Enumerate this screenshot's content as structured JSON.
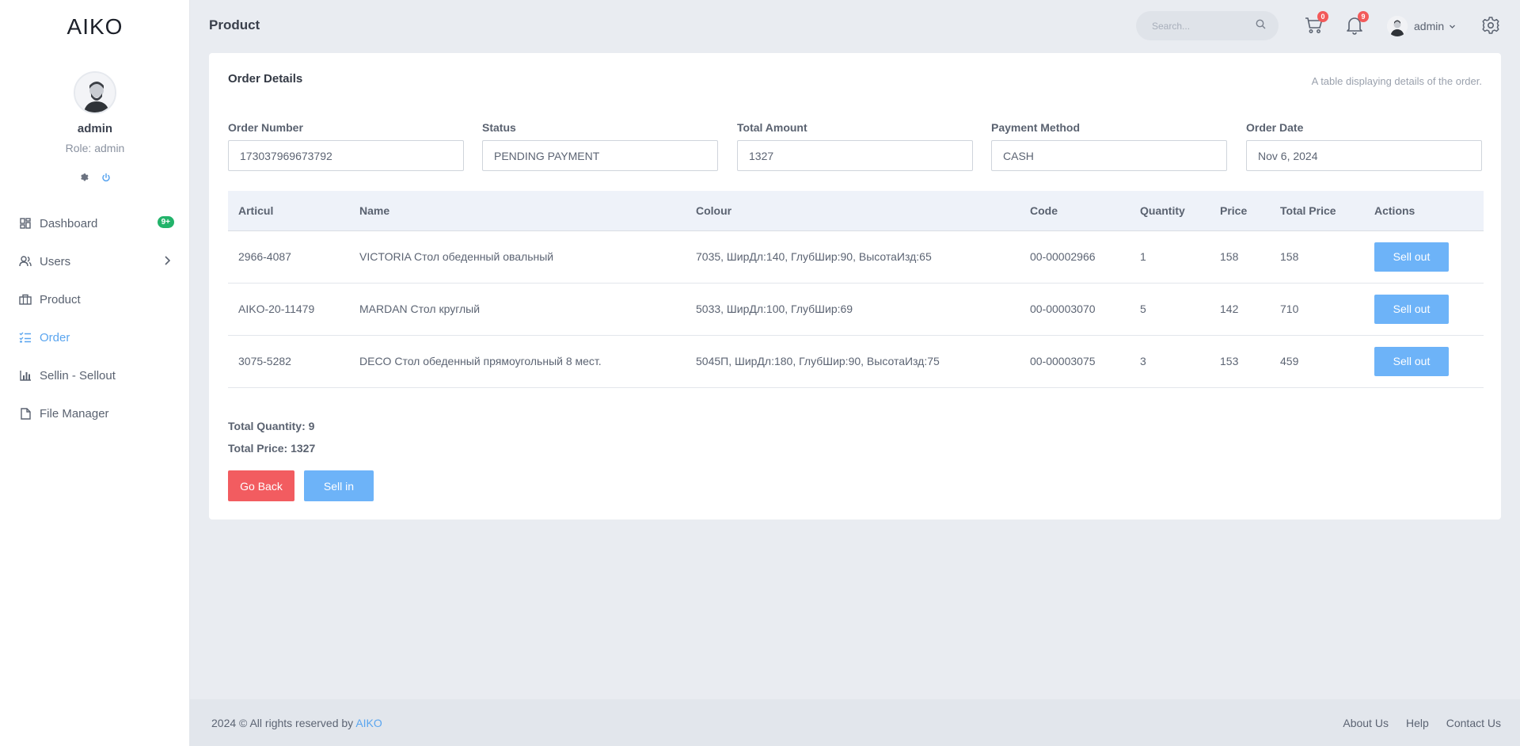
{
  "brand": {
    "logo": "AIKO"
  },
  "sidebar": {
    "user_name": "admin",
    "user_role": "Role: admin",
    "items": [
      {
        "label": "Dashboard",
        "icon": "dashboard-icon",
        "badge": "9+"
      },
      {
        "label": "Users",
        "icon": "users-icon"
      },
      {
        "label": "Product",
        "icon": "product-icon"
      },
      {
        "label": "Order",
        "icon": "order-icon",
        "active": true
      },
      {
        "label": "Sellin - Sellout",
        "icon": "chart-icon"
      },
      {
        "label": "File Manager",
        "icon": "file-icon"
      }
    ]
  },
  "header": {
    "title": "Product",
    "search_placeholder": "Search...",
    "cart_count": "0",
    "notification_count": "9",
    "user_name": "admin"
  },
  "card": {
    "title": "Order Details",
    "description": "A table displaying details of the order.",
    "fields": [
      {
        "label": "Order Number",
        "value": "173037969673792"
      },
      {
        "label": "Status",
        "value": "PENDING PAYMENT"
      },
      {
        "label": "Total Amount",
        "value": "1327"
      },
      {
        "label": "Payment Method",
        "value": "CASH"
      },
      {
        "label": "Order Date",
        "value": "Nov 6, 2024"
      }
    ],
    "table": {
      "columns": [
        "Articul",
        "Name",
        "Colour",
        "Code",
        "Quantity",
        "Price",
        "Total Price",
        "Actions"
      ],
      "rows": [
        {
          "articul": "2966-4087",
          "name": "VICTORIA Стол обеденный овальный",
          "colour": "7035, ШирДл:140, ГлубШир:90, ВысотаИзд:65",
          "code": "00-00002966",
          "quantity": "1",
          "price": "158",
          "total": "158",
          "action": "Sell out"
        },
        {
          "articul": "AIKO-20-11479",
          "name": "MARDAN Стол круглый",
          "colour": "5033, ШирДл:100, ГлубШир:69",
          "code": "00-00003070",
          "quantity": "5",
          "price": "142",
          "total": "710",
          "action": "Sell out"
        },
        {
          "articul": "3075-5282",
          "name": "DECO Стол обеденный прямоугольный 8 мест.",
          "colour": "5045П, ШирДл:180, ГлубШир:90, ВысотаИзд:75",
          "code": "00-00003075",
          "quantity": "3",
          "price": "153",
          "total": "459",
          "action": "Sell out"
        }
      ]
    },
    "total_quantity": "Total Quantity: 9",
    "total_price": "Total Price: 1327",
    "go_back_label": "Go Back",
    "sell_in_label": "Sell in"
  },
  "footer": {
    "copyright": "2024 © All rights reserved by ",
    "brand_link": "AIKO",
    "links": [
      "About Us",
      "Help",
      "Contact Us"
    ]
  },
  "colors": {
    "accent": "#5aa5ef",
    "danger": "#f25c60",
    "success": "#22b36a",
    "button_blue": "#6db3f8"
  }
}
